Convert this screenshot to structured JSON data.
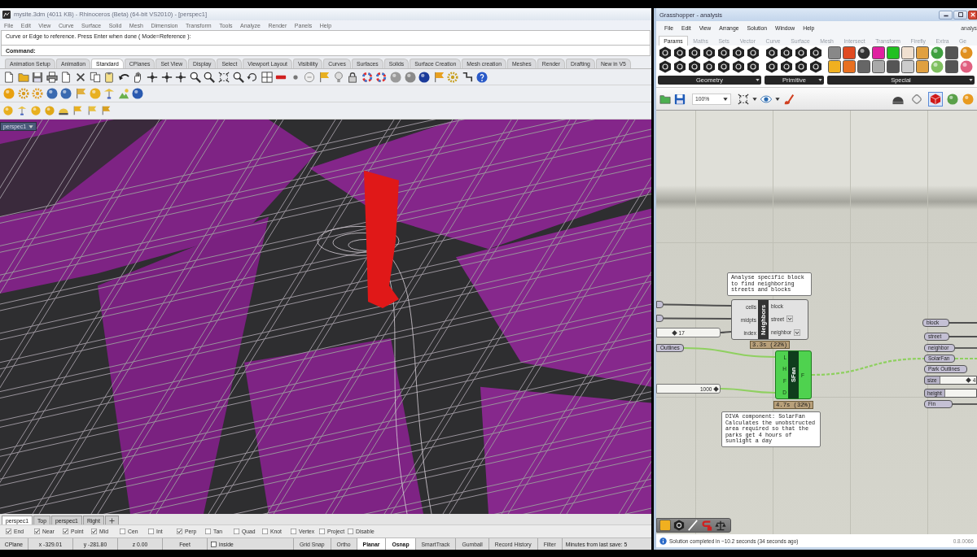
{
  "rhino": {
    "title": "mysite.3dm (4011 KB) - Rhinoceros (Beta) (64-bit VS2010) - [perspec1]",
    "menu": [
      "File",
      "Edit",
      "View",
      "Curve",
      "Surface",
      "Solid",
      "Mesh",
      "Dimension",
      "Transform",
      "Tools",
      "Analyze",
      "Render",
      "Panels",
      "Help"
    ],
    "command_history": "Curve or Edge to reference. Press Enter when done ( Mode=Reference ):",
    "command_prompt": "Command:",
    "toolbar_tabs": [
      {
        "label": "Animation Setup",
        "selected": false
      },
      {
        "label": "Animation",
        "selected": false
      },
      {
        "label": "Standard",
        "selected": true
      },
      {
        "label": "CPlanes",
        "selected": false
      },
      {
        "label": "Set View",
        "selected": false
      },
      {
        "label": "Display",
        "selected": false
      },
      {
        "label": "Select",
        "selected": false
      },
      {
        "label": "Viewport Layout",
        "selected": false
      },
      {
        "label": "Visibility",
        "selected": false
      },
      {
        "label": "Curves",
        "selected": false
      },
      {
        "label": "Surfaces",
        "selected": false
      },
      {
        "label": "Solids",
        "selected": false
      },
      {
        "label": "Surface Creation",
        "selected": false
      },
      {
        "label": "Mesh creation",
        "selected": false
      },
      {
        "label": "Meshes",
        "selected": false
      },
      {
        "label": "Render",
        "selected": false
      },
      {
        "label": "Drafting",
        "selected": false
      },
      {
        "label": "New in V5",
        "selected": false
      }
    ],
    "viewport_title": "perspec1",
    "viewport_tabs": [
      {
        "label": "perspec1",
        "selected": true
      },
      {
        "label": "Top",
        "selected": false
      },
      {
        "label": "perspec1",
        "selected": false
      },
      {
        "label": "Right",
        "selected": false
      }
    ],
    "osnaps": [
      {
        "label": "End",
        "checked": true
      },
      {
        "label": "Near",
        "checked": true
      },
      {
        "label": "Point",
        "checked": true
      },
      {
        "label": "Mid",
        "checked": true
      },
      {
        "label": "Cen",
        "checked": false
      },
      {
        "label": "Int",
        "checked": false
      },
      {
        "label": "Perp",
        "checked": true
      },
      {
        "label": "Tan",
        "checked": false
      },
      {
        "label": "Quad",
        "checked": false
      },
      {
        "label": "Knot",
        "checked": false
      },
      {
        "label": "Vertex",
        "checked": false
      },
      {
        "label": "Project",
        "checked": false
      },
      {
        "label": "Disable",
        "checked": false
      }
    ],
    "status_bar": {
      "cplane": "CPlane",
      "x": "x -329.01",
      "y": "y -281.80",
      "z": "z 0.00",
      "units": "Feet",
      "layer": "inside",
      "toggles": [
        {
          "label": "Grid Snap",
          "on": false
        },
        {
          "label": "Ortho",
          "on": false
        },
        {
          "label": "Planar",
          "on": true
        },
        {
          "label": "Osnap",
          "on": true
        },
        {
          "label": "SmartTrack",
          "on": false
        },
        {
          "label": "Gumball",
          "on": false
        },
        {
          "label": "Record History",
          "on": false
        },
        {
          "label": "Filter",
          "on": false
        }
      ],
      "save_info": "Minutes from last save: 5"
    }
  },
  "grasshopper": {
    "title": "Grasshopper - analysis",
    "menu": [
      "File",
      "Edit",
      "View",
      "Arrange",
      "Solution",
      "Window",
      "Help"
    ],
    "document": "analys",
    "tabs": [
      {
        "label": "Params",
        "selected": true
      },
      {
        "label": "Maths",
        "selected": false
      },
      {
        "label": "Sets",
        "selected": false
      },
      {
        "label": "Vector",
        "selected": false
      },
      {
        "label": "Curve",
        "selected": false
      },
      {
        "label": "Surface",
        "selected": false
      },
      {
        "label": "Mesh",
        "selected": false
      },
      {
        "label": "Intersect",
        "selected": false
      },
      {
        "label": "Transform",
        "selected": false
      },
      {
        "label": "Firefly",
        "selected": false
      },
      {
        "label": "Extra",
        "selected": false
      },
      {
        "label": "Ge",
        "selected": false
      }
    ],
    "panels": [
      "Geometry",
      "Primitive",
      "Special"
    ],
    "zoom": "100%",
    "preview_modes": [
      {
        "selected": false
      },
      {
        "selected": false
      },
      {
        "selected": true
      }
    ],
    "notes": [
      "Analyse specific block to find neighboring streets and blocks",
      "DIVA component: SolarFan Calculates the unobstructed area required so that the parks get 4 hours of sunlight a day"
    ],
    "components": [
      {
        "name": "Neighbors",
        "selected": false,
        "inputs": [
          "cells",
          "midpts",
          "index"
        ],
        "outputs": [
          {
            "label": "block",
            "grafted": false
          },
          {
            "label": "street",
            "grafted": true
          },
          {
            "label": "neighbor",
            "grafted": true
          }
        ],
        "profile": "3.3s (22%)"
      },
      {
        "name": "SFan",
        "selected": true,
        "inputs": [
          "L",
          "H",
          "F",
          "D"
        ],
        "outputs": [
          {
            "label": "F",
            "grafted": false
          }
        ],
        "profile": "4.7s (32%)"
      }
    ],
    "params_left": [
      {
        "kind": "stub"
      },
      {
        "kind": "stub"
      },
      {
        "kind": "slider",
        "value": "17",
        "level": 0.28
      },
      {
        "kind": "param",
        "label": "Outlines"
      },
      {
        "kind": "slider",
        "value": "1000",
        "level": 0.94
      }
    ],
    "params_right": [
      {
        "kind": "param",
        "label": "block"
      },
      {
        "kind": "param",
        "label": "street"
      },
      {
        "kind": "param",
        "label": "neighbor"
      },
      {
        "kind": "param",
        "label": "SolarFan"
      },
      {
        "kind": "param",
        "label": "Park Outlines"
      },
      {
        "kind": "slider",
        "label": "size",
        "value": "4",
        "level": 0.79
      },
      {
        "kind": "field",
        "label": "height"
      },
      {
        "kind": "param",
        "label": "Fin"
      }
    ],
    "status": "Solution completed in ~10.2 seconds (34 seconds ago)",
    "version": "0.8.0066"
  }
}
